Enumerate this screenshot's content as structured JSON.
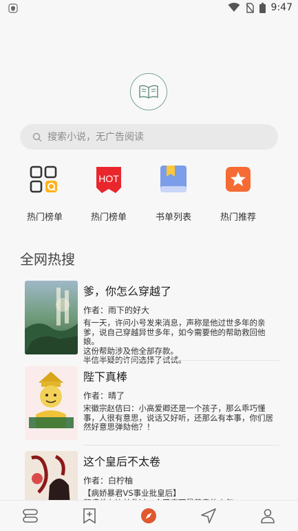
{
  "status_bar": {
    "time": "9:47"
  },
  "logo": {
    "icon": "open-book-icon"
  },
  "search": {
    "placeholder": "搜索小说，无广告阅读"
  },
  "quick_links": [
    {
      "label": "热门榜单",
      "icon": "grid-q-icon"
    },
    {
      "label": "热门榜单",
      "icon": "hot-icon",
      "badge": "HOT"
    },
    {
      "label": "书单列表",
      "icon": "book-list-icon"
    },
    {
      "label": "热门推荐",
      "icon": "star-icon"
    }
  ],
  "section": {
    "title": "全网热搜"
  },
  "books": [
    {
      "title": "爹，你怎么穿越了",
      "author": "作者：雨下的好大",
      "description": "有一天，许问小号发来消息，声称是他过世多年的亲爹，说自己穿越异世多年，如今需要他的帮助救回他娘。\n这份帮助涉及他全部存款。\n半信半疑的许问选择了试试。"
    },
    {
      "title": "陛下真棒",
      "author": "作者：晴了",
      "description": "宋徽宗赵佶曰：小高爱卿还是一个孩子，那么乖巧懂事，人很有意思，说话又好听，还那么有本事，你们居然好意思弹劾他？！"
    },
    {
      "title": "这个皇后不太卷",
      "author": "作者：白柠柚",
      "description": "【病娇暴君VS事业批皇后】\n颜鸢曾在边关救过一个天底下最尊贵的少年，"
    }
  ],
  "bottom_nav": [
    {
      "icon": "bookshelf-icon"
    },
    {
      "icon": "bookmark-add-icon"
    },
    {
      "icon": "compass-icon",
      "active": true
    },
    {
      "icon": "send-icon"
    },
    {
      "icon": "user-icon"
    }
  ],
  "colors": {
    "accent": "#e0582d",
    "hot_red": "#e8262c",
    "recommend_orange": "#f56b33",
    "list_blue": "#7c9de8",
    "list_yellow": "#ffc83a"
  }
}
